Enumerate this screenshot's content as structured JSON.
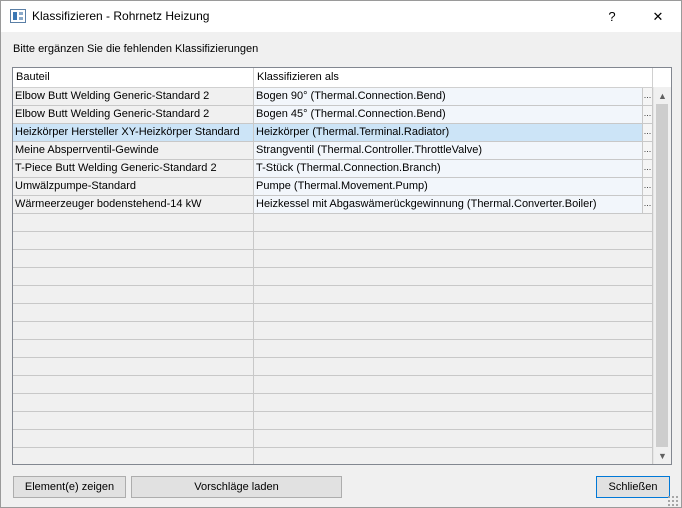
{
  "window": {
    "title": "Klassifizieren - Rohrnetz Heizung",
    "help_label": "?",
    "close_label": "✕"
  },
  "instruction": "Bitte ergänzen Sie die fehlenden Klassifizierungen",
  "grid": {
    "columns": [
      "Bauteil",
      "Klassifizieren als"
    ],
    "ellipsis_label": "...",
    "rows": [
      {
        "bauteil": "Elbow Butt Welding Generic-Standard 2",
        "klassifizieren": "Bogen 90° (Thermal.Connection.Bend)"
      },
      {
        "bauteil": "Elbow Butt Welding Generic-Standard 2",
        "klassifizieren": "Bogen 45° (Thermal.Connection.Bend)"
      },
      {
        "bauteil": "Heizkörper Hersteller XY-Heizkörper Standard",
        "klassifizieren": "Heizkörper (Thermal.Terminal.Radiator)"
      },
      {
        "bauteil": "Meine Absperrventil-Gewinde",
        "klassifizieren": "Strangventil (Thermal.Controller.ThrottleValve)"
      },
      {
        "bauteil": "T-Piece Butt Welding Generic-Standard 2",
        "klassifizieren": "T-Stück (Thermal.Connection.Branch)"
      },
      {
        "bauteil": "Umwälzpumpe-Standard",
        "klassifizieren": "Pumpe (Thermal.Movement.Pump)"
      },
      {
        "bauteil": "Wärmeerzeuger bodenstehend-14 kW",
        "klassifizieren": "Heizkessel mit Abgaswämerückgewinnung (Thermal.Converter.Boiler)"
      }
    ],
    "selected_row": 2,
    "scroll_up": "▲",
    "scroll_down": "▼"
  },
  "buttons": {
    "show_elements": "Element(e) zeigen",
    "load_suggestions": "Vorschläge laden",
    "close": "Schließen"
  }
}
